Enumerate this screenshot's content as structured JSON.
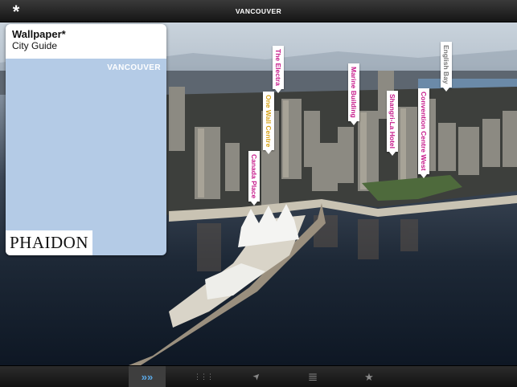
{
  "app": {
    "menu_icon": "asterisk-icon",
    "menu_glyph": "*",
    "title": "VANCOUVER"
  },
  "card": {
    "brand": "Wallpaper*",
    "subtitle": "City Guide",
    "city": "VANCOUVER",
    "publisher": "PHAIDON"
  },
  "pins": [
    {
      "label": "The Electra",
      "color": "#c6198a"
    },
    {
      "label": "One Wall Centre",
      "color": "#d7a319"
    },
    {
      "label": "Canada Place",
      "color": "#c6198a"
    },
    {
      "label": "Marine Building",
      "color": "#c6198a"
    },
    {
      "label": "Shangri-La Hotel",
      "color": "#c6198a"
    },
    {
      "label": "Convention Centre West",
      "color": "#c6198a"
    },
    {
      "label": "English Bay",
      "color": "#777777"
    }
  ],
  "toolbar": [
    {
      "name": "next-icon",
      "glyph": "»»",
      "active": true
    },
    {
      "name": "grid-icon",
      "glyph": "⋮⋮⋮",
      "active": false
    },
    {
      "name": "location-arrow-icon",
      "glyph": "➤",
      "active": false
    },
    {
      "name": "list-icon",
      "glyph": "≣",
      "active": false
    },
    {
      "name": "star-icon",
      "glyph": "★",
      "active": false
    }
  ],
  "colors": {
    "card_bg": "#b4cbe6",
    "pin_text": "#c6198a",
    "active_tab": "#5aa8e6"
  }
}
